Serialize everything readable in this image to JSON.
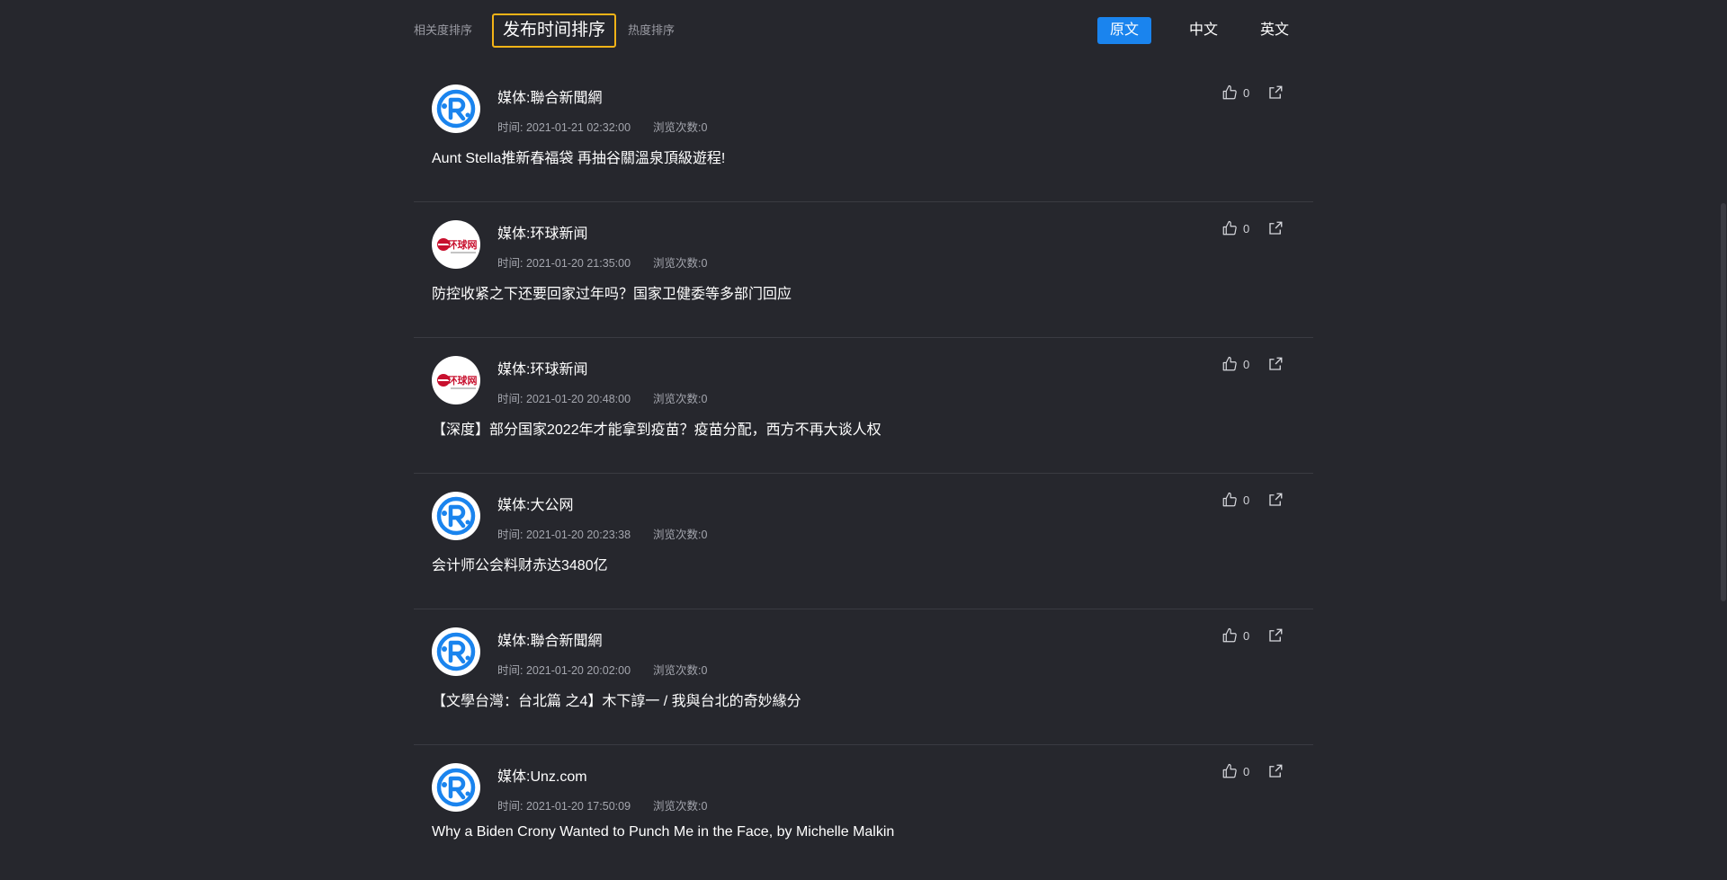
{
  "sort": {
    "relevance": "相关度排序",
    "publish_time": "发布时间排序",
    "popularity": "热度排序"
  },
  "lang": {
    "original": "原文",
    "chinese": "中文",
    "english": "英文"
  },
  "items": [
    {
      "media": "媒体:聯合新聞網",
      "time": "时间: 2021-01-21 02:32:00",
      "views": "浏览次数:0",
      "title": "Aunt Stella推新春福袋 再抽谷關溫泉頂級遊程!",
      "likes": "0",
      "logo": "r-logo"
    },
    {
      "media": "媒体:环球新闻",
      "time": "时间: 2021-01-20 21:35:00",
      "views": "浏览次数:0",
      "title": "防控收紧之下还要回家过年吗？国家卫健委等多部门回应",
      "likes": "0",
      "logo": "huanqiu-logo",
      "logo_text": "环球网"
    },
    {
      "media": "媒体:环球新闻",
      "time": "时间: 2021-01-20 20:48:00",
      "views": "浏览次数:0",
      "title": "【深度】部分国家2022年才能拿到疫苗？疫苗分配，西方不再大谈人权",
      "likes": "0",
      "logo": "huanqiu-logo",
      "logo_text": "环球网"
    },
    {
      "media": "媒体:大公网",
      "time": "时间: 2021-01-20 20:23:38",
      "views": "浏览次数:0",
      "title": "会计师公会料财赤达3480亿",
      "likes": "0",
      "logo": "r-logo"
    },
    {
      "media": "媒体:聯合新聞網",
      "time": "时间: 2021-01-20 20:02:00",
      "views": "浏览次数:0",
      "title": "【文學台灣：台北篇 之4】木下諄一 / 我與台北的奇妙緣分",
      "likes": "0",
      "logo": "r-logo"
    },
    {
      "media": "媒体:Unz.com",
      "time": "时间: 2021-01-20 17:50:09",
      "views": "浏览次数:0",
      "title": "Why a Biden Crony Wanted to Punch Me in the Face, by Michelle Malkin",
      "likes": "0",
      "logo": "r-logo"
    }
  ],
  "colors": {
    "background": "#26272d",
    "accent_blue": "#1a84ee",
    "active_border": "#f3b317",
    "logo_red": "#c8102e"
  }
}
